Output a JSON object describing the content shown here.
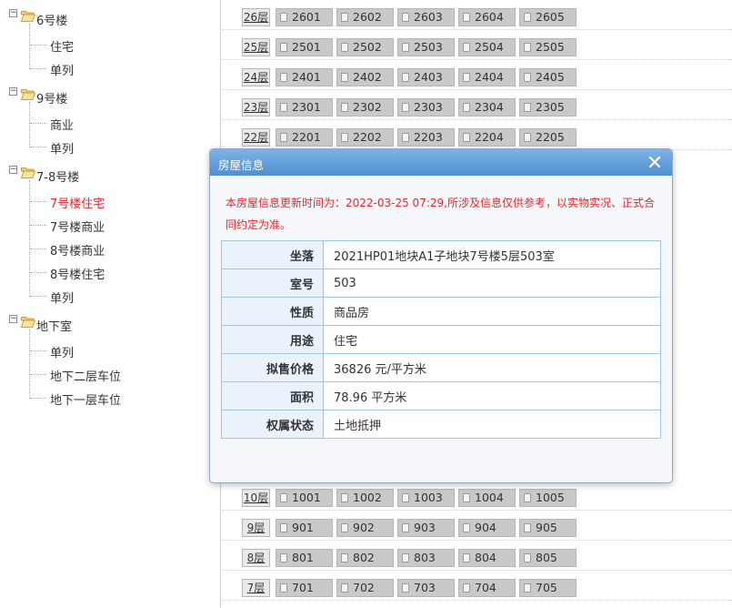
{
  "tree": {
    "groups": [
      {
        "label": "6号楼",
        "toggle": "−",
        "items": [
          {
            "label": "住宅",
            "active": false
          },
          {
            "label": "单列",
            "active": false
          }
        ]
      },
      {
        "label": "9号楼",
        "toggle": "−",
        "items": [
          {
            "label": "商业",
            "active": false
          },
          {
            "label": "单列",
            "active": false
          }
        ]
      },
      {
        "label": "7-8号楼",
        "toggle": "−",
        "items": [
          {
            "label": "7号楼住宅",
            "active": true
          },
          {
            "label": "7号楼商业",
            "active": false
          },
          {
            "label": "8号楼商业",
            "active": false
          },
          {
            "label": "8号楼住宅",
            "active": false
          },
          {
            "label": "单列",
            "active": false
          }
        ]
      },
      {
        "label": "地下室",
        "toggle": "−",
        "items": [
          {
            "label": "单列",
            "active": false
          },
          {
            "label": "地下二层车位",
            "active": false
          },
          {
            "label": "地下一层车位",
            "active": false
          }
        ]
      }
    ]
  },
  "grid": {
    "rows": [
      {
        "floor": "26层",
        "units": [
          "2601",
          "2602",
          "2603",
          "2604",
          "2605"
        ]
      },
      {
        "floor": "25层",
        "units": [
          "2501",
          "2502",
          "2503",
          "2504",
          "2505"
        ]
      },
      {
        "floor": "24层",
        "units": [
          "2401",
          "2402",
          "2403",
          "2404",
          "2405"
        ]
      },
      {
        "floor": "23层",
        "units": [
          "2301",
          "2302",
          "2303",
          "2304",
          "2305"
        ]
      },
      {
        "floor": "22层",
        "units": [
          "2201",
          "2202",
          "2203",
          "2204",
          "2205"
        ]
      },
      {
        "floor": "10层",
        "units": [
          "1001",
          "1002",
          "1003",
          "1004",
          "1005"
        ]
      },
      {
        "floor": "9层",
        "units": [
          "901",
          "902",
          "903",
          "904",
          "905"
        ]
      },
      {
        "floor": "8层",
        "units": [
          "801",
          "802",
          "803",
          "804",
          "805"
        ]
      },
      {
        "floor": "7层",
        "units": [
          "701",
          "702",
          "703",
          "704",
          "705"
        ]
      }
    ]
  },
  "modal": {
    "title": "房屋信息",
    "close_icon": "close-icon",
    "notice": "本房屋信息更新时间为：2022-03-25 07:29,所涉及信息仅供参考，以实物实况、正式合同约定为准。",
    "fields": [
      {
        "key": "坐落",
        "value": "2021HP01地块A1子地块7号楼5层503室"
      },
      {
        "key": "室号",
        "value": "503"
      },
      {
        "key": "性质",
        "value": "商品房"
      },
      {
        "key": "用途",
        "value": "住宅"
      },
      {
        "key": "拟售价格",
        "value": "36826 元/平方米"
      },
      {
        "key": "面积",
        "value": "78.96 平方米"
      },
      {
        "key": "权属状态",
        "value": "土地抵押"
      }
    ]
  },
  "colors": {
    "active_text": "#e8262a",
    "notice_text": "#e8262a",
    "title_bar": "#5f9bd8",
    "table_border": "#9cc6e6"
  }
}
